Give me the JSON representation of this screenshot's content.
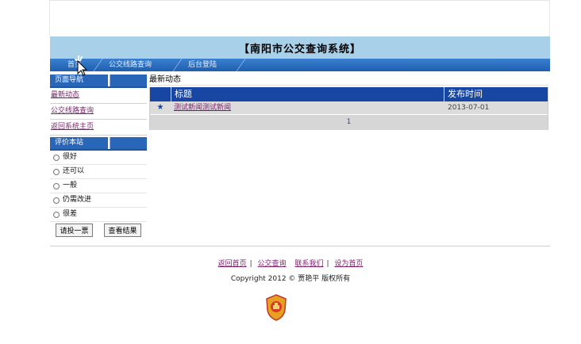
{
  "header": {
    "title": "【南阳市公交查询系统】"
  },
  "nav": {
    "items": [
      "首页",
      "公交线路查询",
      "后台登陆"
    ]
  },
  "sidebar": {
    "nav_heading": "页面导航",
    "links": [
      "最新动态",
      "公交线路查询",
      "返回系统主页"
    ],
    "vote_heading": "评价本站",
    "vote_options": [
      "很好",
      "还可以",
      "一般",
      "仍需改进",
      "很差"
    ],
    "vote_button": "请投一票",
    "result_button": "查看结果"
  },
  "main": {
    "title": "最新动态",
    "columns": {
      "title": "标题",
      "date": "发布时间"
    },
    "rows": [
      {
        "icon": "★",
        "title": "测试新闻测试新闻",
        "date": "2013-07-01"
      }
    ],
    "pager": "1"
  },
  "footer": {
    "links": [
      "返回首页",
      "公交查询",
      "联系我们",
      "设为首页"
    ],
    "copyright": "Copyright  2012 ©    贾艳平   版权所有"
  },
  "colors": {
    "banner": "#a8d0e8",
    "nav": "#1f5fae",
    "table_header": "#1747a3",
    "link": "#7a1f6a"
  }
}
